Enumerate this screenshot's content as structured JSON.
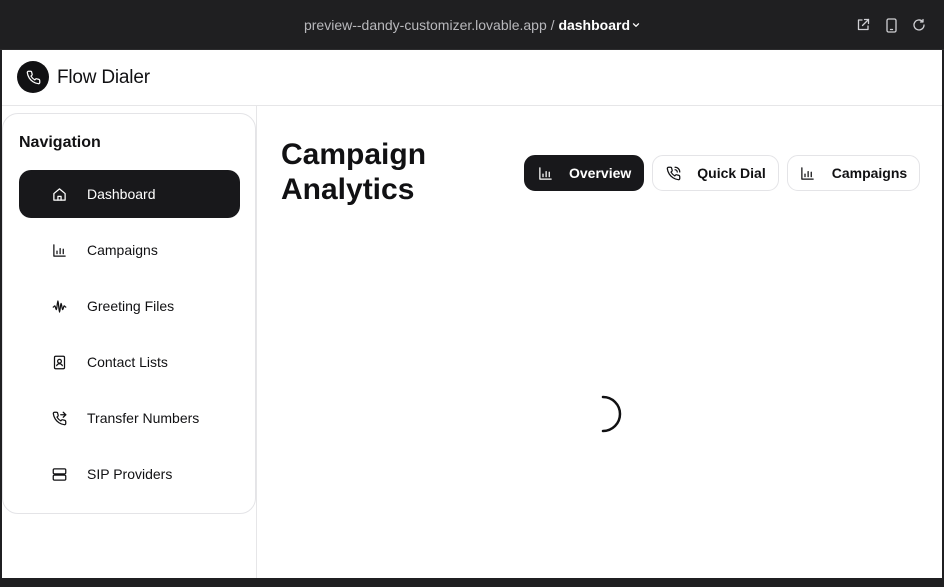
{
  "browser": {
    "url_host": "preview--dandy-customizer.lovable.app",
    "url_separator": " / ",
    "url_path": "dashboard",
    "icons": [
      "external-link-icon",
      "mobile-device-icon",
      "refresh-icon"
    ]
  },
  "app": {
    "brand": "Flow Dialer",
    "logo_icon": "phone-icon"
  },
  "sidebar": {
    "title": "Navigation",
    "items": [
      {
        "label": "Dashboard",
        "icon": "home-icon",
        "active": true
      },
      {
        "label": "Campaigns",
        "icon": "bar-chart-icon",
        "active": false
      },
      {
        "label": "Greeting Files",
        "icon": "audio-wave-icon",
        "active": false
      },
      {
        "label": "Contact Lists",
        "icon": "contact-card-icon",
        "active": false
      },
      {
        "label": "Transfer Numbers",
        "icon": "phone-forward-icon",
        "active": false
      },
      {
        "label": "SIP Providers",
        "icon": "server-icon",
        "active": false
      }
    ]
  },
  "main": {
    "title": "Campaign Analytics",
    "tabs": [
      {
        "label": "Overview",
        "icon": "bar-chart-icon",
        "active": true
      },
      {
        "label": "Quick Dial",
        "icon": "phone-call-icon",
        "active": false
      },
      {
        "label": "Campaigns",
        "icon": "bar-chart-icon",
        "active": false
      }
    ],
    "loading": true
  },
  "colors": {
    "primary": "#18181b",
    "border": "#e4e4e7",
    "chrome": "#1f1f21"
  }
}
